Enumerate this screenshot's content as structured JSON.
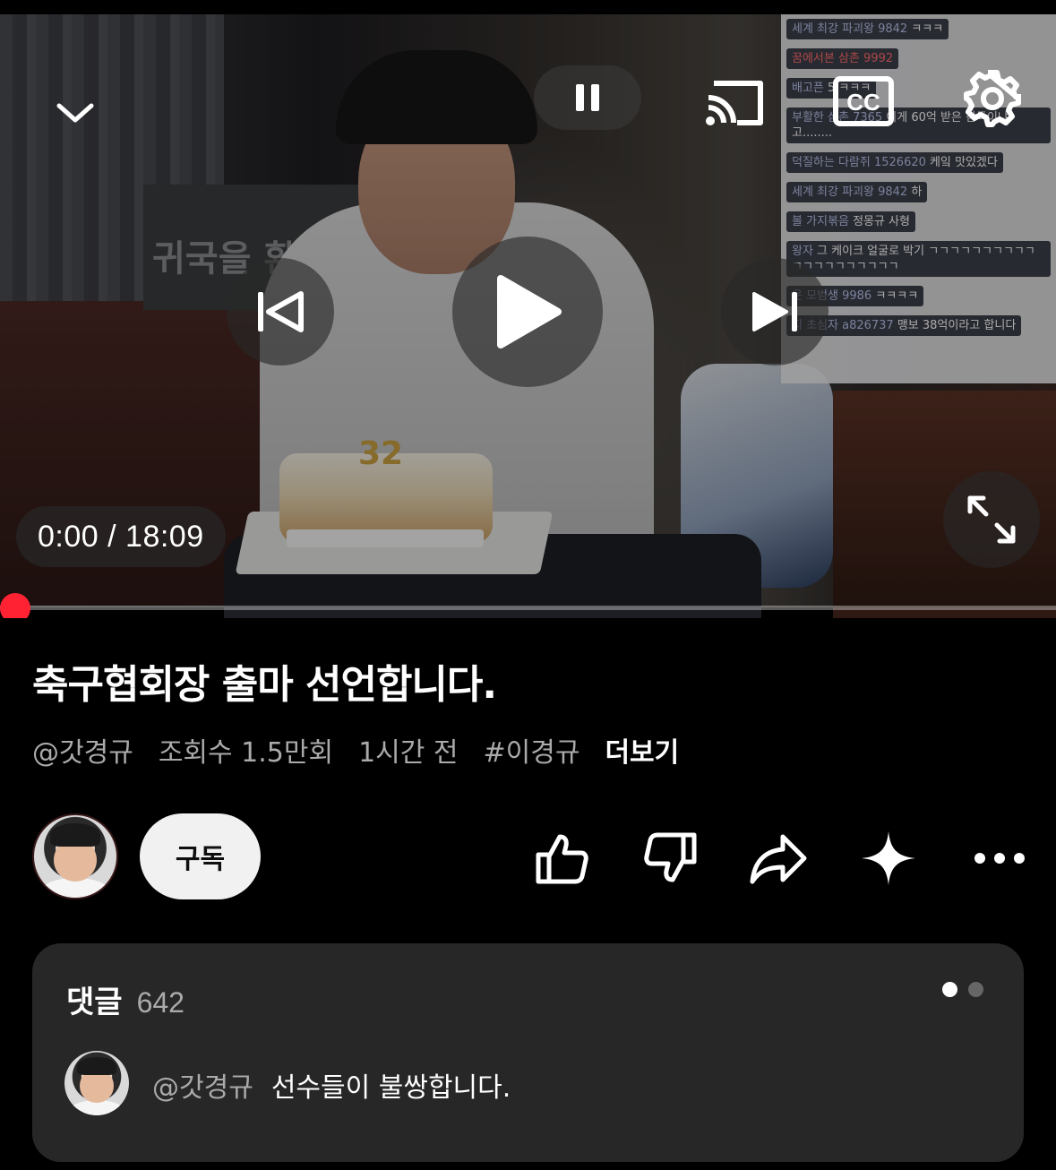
{
  "player": {
    "time_current": "0:00",
    "time_total": "18:09",
    "time_separator": " / ",
    "progress": 0.0,
    "accent_color": "#ff0000",
    "icons": {
      "collapse": "chevron-down-icon",
      "pause": "pause-icon",
      "cast": "cast-icon",
      "captions": "cc-icon",
      "settings": "gear-icon",
      "previous": "skip-previous-icon",
      "play": "play-icon",
      "next": "skip-next-icon",
      "fullscreen": "fullscreen-icon"
    },
    "cc_label": "CC",
    "scene": {
      "poster_text": "귀국을 환영",
      "candles": "32",
      "chat": [
        {
          "name": "세계 최강 파괴왕 9842",
          "msg": "ㅋㅋㅋ"
        },
        {
          "name": "꿈에서본 삼촌 9992",
          "msg": "",
          "red": true
        },
        {
          "name": "배고픈 ",
          "msg": "5 ㅋㅋㅋ"
        },
        {
          "name": "부활한 삼촌 7365",
          "msg": "이게 60억 받은 감독이냐고........"
        },
        {
          "name": "덕질하는 다람쥐 1526620",
          "msg": "케잌 맛있겠다"
        },
        {
          "name": "세계 최강 파괴왕 9842",
          "msg": "하"
        },
        {
          "name": "볼 가지볶음",
          "msg": "정몽규 사형"
        },
        {
          "name": "왕자",
          "msg": "그 케이크 얼굴로 박기 ㄱㄱㄱㄱㄱㄱㄱㄱㄱㄱㄱㄱㄱㄱㄱㄱㄱㄱㄱㄱ"
        },
        {
          "name": "운 모범생 9986",
          "msg": "ㅋㅋㅋㅋ"
        },
        {
          "name": "지 초심자 a826737",
          "msg": "맹보 38억이라고 합니다"
        }
      ]
    }
  },
  "video": {
    "title": "축구협회장 출마 선언합니다.",
    "channel_handle": "@갓경규",
    "views": "조회수 1.5만회",
    "time_ago": "1시간 전",
    "hashtag": "#이경규",
    "more_label": "더보기"
  },
  "actions": {
    "subscribe_label": "구독",
    "icons": {
      "like": "thumbs-up-icon",
      "dislike": "thumbs-down-icon",
      "share": "share-icon",
      "remix": "sparkle-icon",
      "more": "more-horizontal-icon"
    }
  },
  "comments": {
    "label": "댓글",
    "count": "642",
    "top_comment": {
      "author": "@갓경규",
      "text": "선수들이 불쌍합니다."
    }
  }
}
